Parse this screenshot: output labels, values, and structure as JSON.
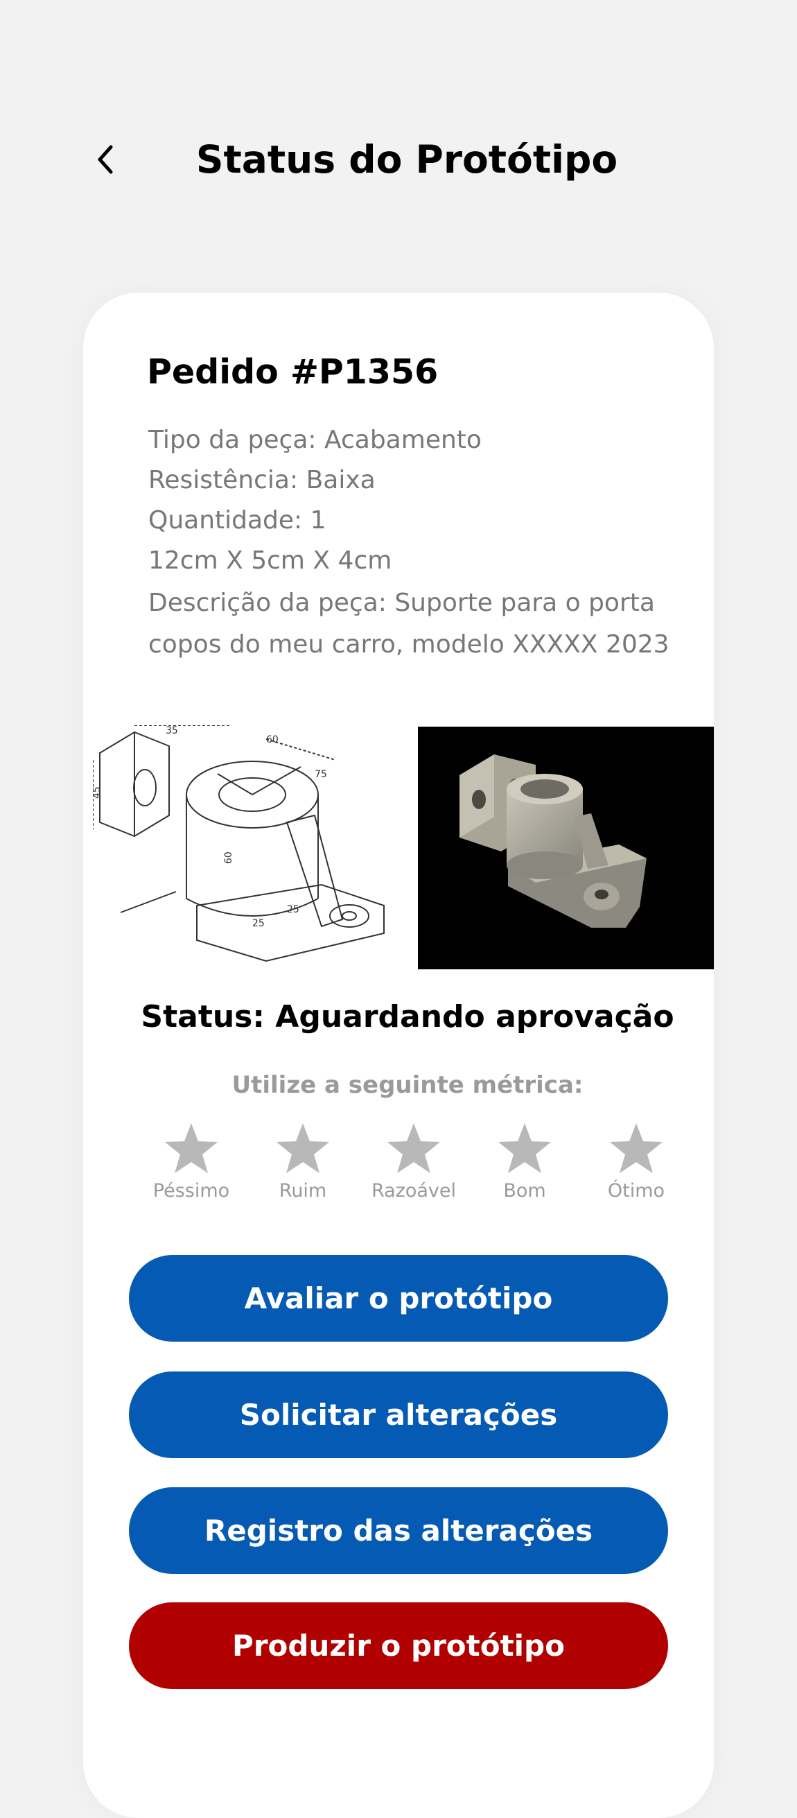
{
  "header": {
    "title": "Status do Protótipo",
    "back_icon": "chevron-left-icon"
  },
  "order": {
    "title": "Pedido #P1356",
    "part_type": "Tipo da peça: Acabamento",
    "resistance": "Resistência: Baixa",
    "quantity": "Quantidade: 1",
    "dimensions": "12cm X 5cm X 4cm",
    "description_line1": "Descrição da peça: Suporte para o porta",
    "description_line2": "copos do meu carro, modelo XXXXX 2023"
  },
  "images": {
    "drawing": "technical-drawing-image",
    "render": "3d-render-image"
  },
  "status": {
    "text": "Status: Aguardando aprovação"
  },
  "rating": {
    "label": "Utilize a seguinte métrica:",
    "star_color": "#b8b8b8",
    "items": [
      {
        "label": "Péssimo"
      },
      {
        "label": "Ruim"
      },
      {
        "label": "Razoável"
      },
      {
        "label": "Bom"
      },
      {
        "label": "Ótimo"
      }
    ]
  },
  "actions": {
    "evaluate": "Avaliar o protótipo",
    "request_changes": "Solicitar alterações",
    "change_log": "Registro das alterações",
    "produce": "Produzir o protótipo",
    "primary_color": "#055ab4",
    "danger_color": "#b00000"
  }
}
